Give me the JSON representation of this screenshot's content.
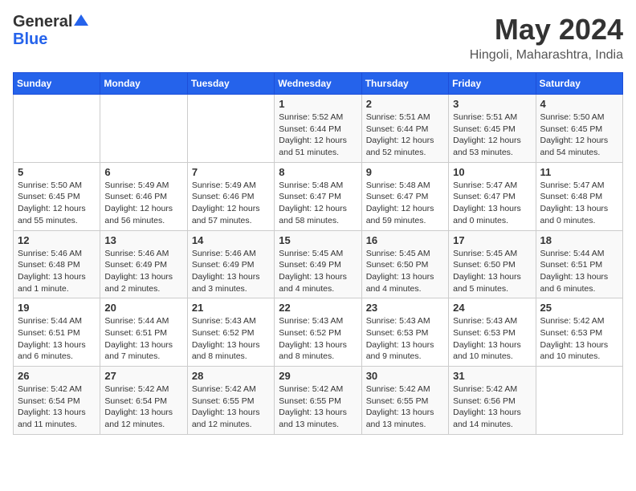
{
  "header": {
    "logo_general": "General",
    "logo_blue": "Blue",
    "month": "May 2024",
    "location": "Hingoli, Maharashtra, India"
  },
  "weekdays": [
    "Sunday",
    "Monday",
    "Tuesday",
    "Wednesday",
    "Thursday",
    "Friday",
    "Saturday"
  ],
  "weeks": [
    [
      {
        "day": "",
        "content": ""
      },
      {
        "day": "",
        "content": ""
      },
      {
        "day": "",
        "content": ""
      },
      {
        "day": "1",
        "content": "Sunrise: 5:52 AM\nSunset: 6:44 PM\nDaylight: 12 hours\nand 51 minutes."
      },
      {
        "day": "2",
        "content": "Sunrise: 5:51 AM\nSunset: 6:44 PM\nDaylight: 12 hours\nand 52 minutes."
      },
      {
        "day": "3",
        "content": "Sunrise: 5:51 AM\nSunset: 6:45 PM\nDaylight: 12 hours\nand 53 minutes."
      },
      {
        "day": "4",
        "content": "Sunrise: 5:50 AM\nSunset: 6:45 PM\nDaylight: 12 hours\nand 54 minutes."
      }
    ],
    [
      {
        "day": "5",
        "content": "Sunrise: 5:50 AM\nSunset: 6:45 PM\nDaylight: 12 hours\nand 55 minutes."
      },
      {
        "day": "6",
        "content": "Sunrise: 5:49 AM\nSunset: 6:46 PM\nDaylight: 12 hours\nand 56 minutes."
      },
      {
        "day": "7",
        "content": "Sunrise: 5:49 AM\nSunset: 6:46 PM\nDaylight: 12 hours\nand 57 minutes."
      },
      {
        "day": "8",
        "content": "Sunrise: 5:48 AM\nSunset: 6:47 PM\nDaylight: 12 hours\nand 58 minutes."
      },
      {
        "day": "9",
        "content": "Sunrise: 5:48 AM\nSunset: 6:47 PM\nDaylight: 12 hours\nand 59 minutes."
      },
      {
        "day": "10",
        "content": "Sunrise: 5:47 AM\nSunset: 6:47 PM\nDaylight: 13 hours\nand 0 minutes."
      },
      {
        "day": "11",
        "content": "Sunrise: 5:47 AM\nSunset: 6:48 PM\nDaylight: 13 hours\nand 0 minutes."
      }
    ],
    [
      {
        "day": "12",
        "content": "Sunrise: 5:46 AM\nSunset: 6:48 PM\nDaylight: 13 hours\nand 1 minute."
      },
      {
        "day": "13",
        "content": "Sunrise: 5:46 AM\nSunset: 6:49 PM\nDaylight: 13 hours\nand 2 minutes."
      },
      {
        "day": "14",
        "content": "Sunrise: 5:46 AM\nSunset: 6:49 PM\nDaylight: 13 hours\nand 3 minutes."
      },
      {
        "day": "15",
        "content": "Sunrise: 5:45 AM\nSunset: 6:49 PM\nDaylight: 13 hours\nand 4 minutes."
      },
      {
        "day": "16",
        "content": "Sunrise: 5:45 AM\nSunset: 6:50 PM\nDaylight: 13 hours\nand 4 minutes."
      },
      {
        "day": "17",
        "content": "Sunrise: 5:45 AM\nSunset: 6:50 PM\nDaylight: 13 hours\nand 5 minutes."
      },
      {
        "day": "18",
        "content": "Sunrise: 5:44 AM\nSunset: 6:51 PM\nDaylight: 13 hours\nand 6 minutes."
      }
    ],
    [
      {
        "day": "19",
        "content": "Sunrise: 5:44 AM\nSunset: 6:51 PM\nDaylight: 13 hours\nand 6 minutes."
      },
      {
        "day": "20",
        "content": "Sunrise: 5:44 AM\nSunset: 6:51 PM\nDaylight: 13 hours\nand 7 minutes."
      },
      {
        "day": "21",
        "content": "Sunrise: 5:43 AM\nSunset: 6:52 PM\nDaylight: 13 hours\nand 8 minutes."
      },
      {
        "day": "22",
        "content": "Sunrise: 5:43 AM\nSunset: 6:52 PM\nDaylight: 13 hours\nand 8 minutes."
      },
      {
        "day": "23",
        "content": "Sunrise: 5:43 AM\nSunset: 6:53 PM\nDaylight: 13 hours\nand 9 minutes."
      },
      {
        "day": "24",
        "content": "Sunrise: 5:43 AM\nSunset: 6:53 PM\nDaylight: 13 hours\nand 10 minutes."
      },
      {
        "day": "25",
        "content": "Sunrise: 5:42 AM\nSunset: 6:53 PM\nDaylight: 13 hours\nand 10 minutes."
      }
    ],
    [
      {
        "day": "26",
        "content": "Sunrise: 5:42 AM\nSunset: 6:54 PM\nDaylight: 13 hours\nand 11 minutes."
      },
      {
        "day": "27",
        "content": "Sunrise: 5:42 AM\nSunset: 6:54 PM\nDaylight: 13 hours\nand 12 minutes."
      },
      {
        "day": "28",
        "content": "Sunrise: 5:42 AM\nSunset: 6:55 PM\nDaylight: 13 hours\nand 12 minutes."
      },
      {
        "day": "29",
        "content": "Sunrise: 5:42 AM\nSunset: 6:55 PM\nDaylight: 13 hours\nand 13 minutes."
      },
      {
        "day": "30",
        "content": "Sunrise: 5:42 AM\nSunset: 6:55 PM\nDaylight: 13 hours\nand 13 minutes."
      },
      {
        "day": "31",
        "content": "Sunrise: 5:42 AM\nSunset: 6:56 PM\nDaylight: 13 hours\nand 14 minutes."
      },
      {
        "day": "",
        "content": ""
      }
    ]
  ]
}
